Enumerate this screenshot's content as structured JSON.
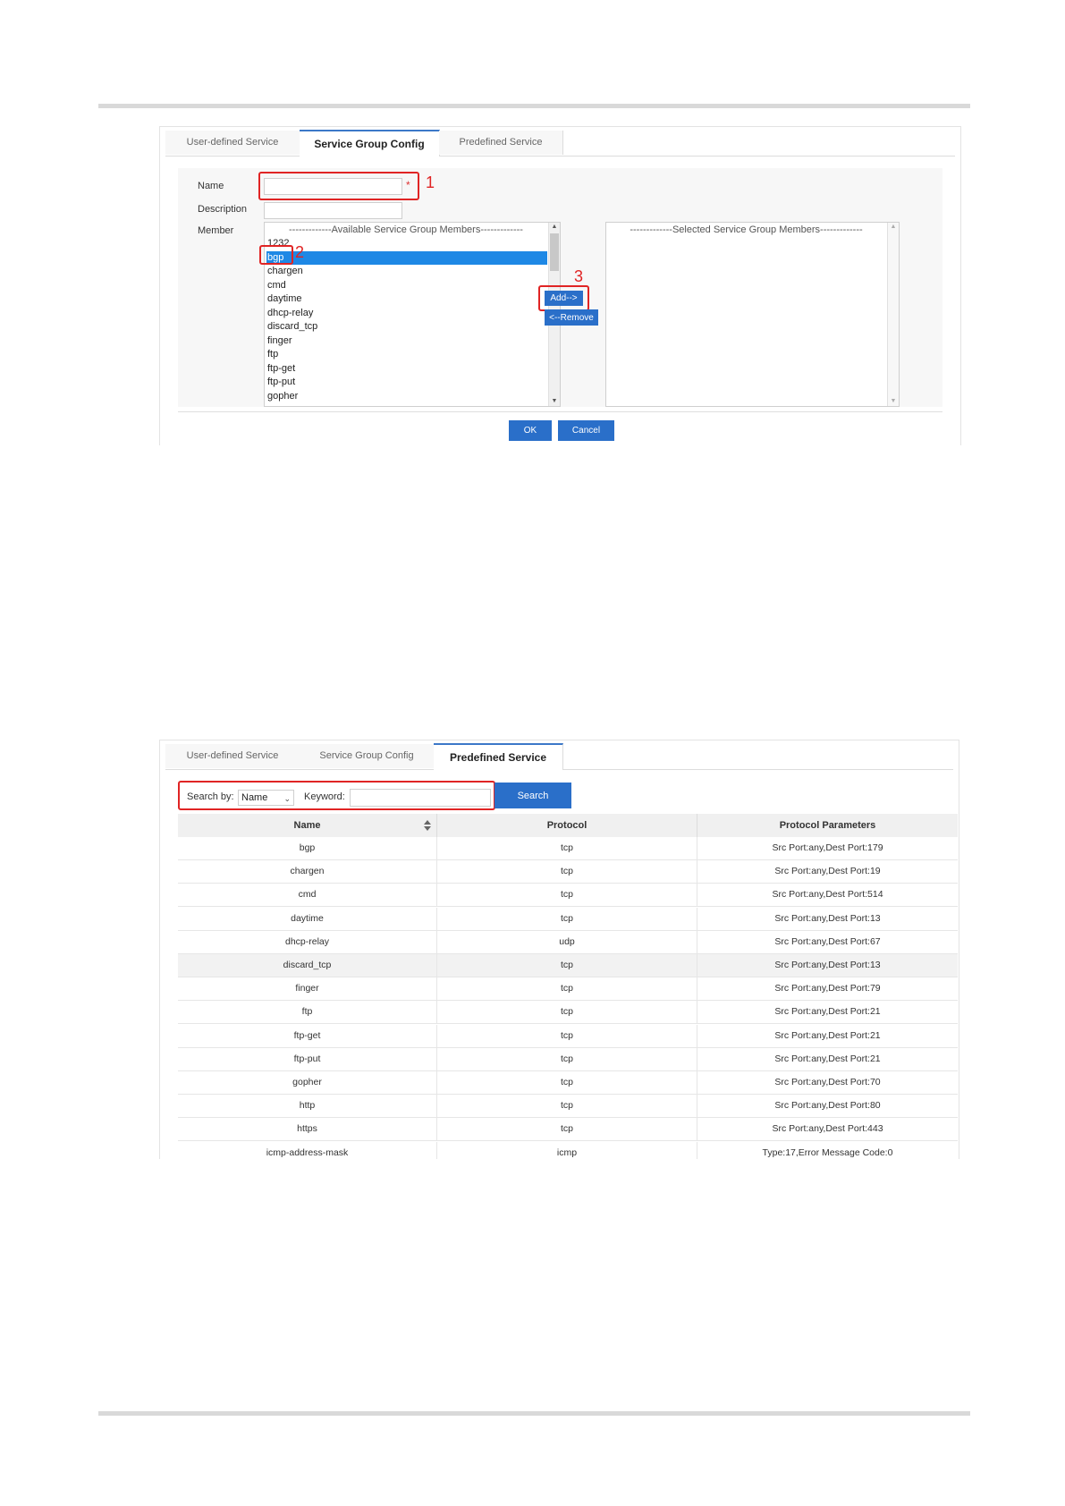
{
  "screenshot1": {
    "tabs": [
      {
        "label": "User-defined Service",
        "active": false
      },
      {
        "label": "Service Group Config",
        "active": true
      },
      {
        "label": "Predefined Service",
        "active": false
      }
    ],
    "form": {
      "name_label": "Name",
      "description_label": "Description",
      "member_label": "Member",
      "required_mark": "*",
      "name_value": "",
      "description_value": ""
    },
    "available_members": {
      "header": "-------------Available Service Group Members-------------",
      "items": [
        "1232",
        "bgp",
        "chargen",
        "cmd",
        "daytime",
        "dhcp-relay",
        "discard_tcp",
        "finger",
        "ftp",
        "ftp-get",
        "ftp-put",
        "gopher"
      ],
      "selected": "bgp"
    },
    "selected_members": {
      "header": "-------------Selected Service Group Members-------------",
      "items": []
    },
    "buttons": {
      "add": "Add-->",
      "remove": "<--Remove",
      "ok": "OK",
      "cancel": "Cancel"
    },
    "callouts": [
      "1",
      "2",
      "3"
    ]
  },
  "screenshot2": {
    "tabs": [
      {
        "label": "User-defined Service",
        "active": false
      },
      {
        "label": "Service Group Config",
        "active": false
      },
      {
        "label": "Predefined Service",
        "active": true
      }
    ],
    "search": {
      "search_by_label": "Search by:",
      "search_by_value": "Name",
      "keyword_label": "Keyword:",
      "keyword_value": "",
      "button": "Search"
    },
    "table": {
      "columns": [
        "Name",
        "Protocol",
        "Protocol Parameters"
      ],
      "rows": [
        {
          "name": "bgp",
          "protocol": "tcp",
          "params": "Src Port:any,Dest Port:179"
        },
        {
          "name": "chargen",
          "protocol": "tcp",
          "params": "Src Port:any,Dest Port:19"
        },
        {
          "name": "cmd",
          "protocol": "tcp",
          "params": "Src Port:any,Dest Port:514"
        },
        {
          "name": "daytime",
          "protocol": "tcp",
          "params": "Src Port:any,Dest Port:13"
        },
        {
          "name": "dhcp-relay",
          "protocol": "udp",
          "params": "Src Port:any,Dest Port:67"
        },
        {
          "name": "discard_tcp",
          "protocol": "tcp",
          "params": "Src Port:any,Dest Port:13"
        },
        {
          "name": "finger",
          "protocol": "tcp",
          "params": "Src Port:any,Dest Port:79"
        },
        {
          "name": "ftp",
          "protocol": "tcp",
          "params": "Src Port:any,Dest Port:21"
        },
        {
          "name": "ftp-get",
          "protocol": "tcp",
          "params": "Src Port:any,Dest Port:21"
        },
        {
          "name": "ftp-put",
          "protocol": "tcp",
          "params": "Src Port:any,Dest Port:21"
        },
        {
          "name": "gopher",
          "protocol": "tcp",
          "params": "Src Port:any,Dest Port:70"
        },
        {
          "name": "http",
          "protocol": "tcp",
          "params": "Src Port:any,Dest Port:80"
        },
        {
          "name": "https",
          "protocol": "tcp",
          "params": "Src Port:any,Dest Port:443"
        },
        {
          "name": "icmp-address-mask",
          "protocol": "icmp",
          "params": "Type:17,Error Message Code:0"
        }
      ],
      "highlighted_row": 5
    }
  },
  "colors": {
    "accent": "#2a6fc9",
    "selection": "#1e88e5",
    "callout": "#e02424"
  },
  "icons": {
    "sort": "sort-updown-icon",
    "dropdown": "chevron-down-icon",
    "scroll_up": "triangle-up-icon",
    "scroll_down": "triangle-down-icon"
  }
}
